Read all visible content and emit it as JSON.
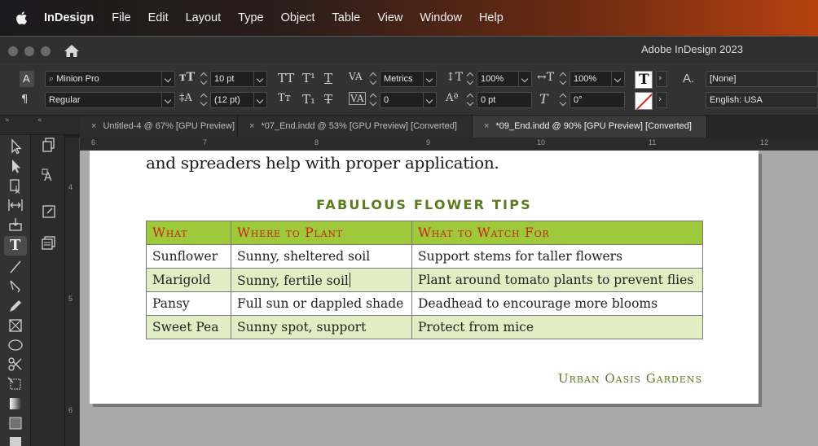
{
  "menubar": {
    "app": "InDesign",
    "items": [
      "File",
      "Edit",
      "Layout",
      "Type",
      "Object",
      "Table",
      "View",
      "Window",
      "Help"
    ]
  },
  "window": {
    "title": "Adobe InDesign 2023"
  },
  "control": {
    "font_family": "Minion Pro",
    "font_style": "Regular",
    "font_size": "10 pt",
    "leading": "(12 pt)",
    "kerning": "Metrics",
    "tracking": "0",
    "vertical_scale": "100%",
    "horizontal_scale": "100%",
    "baseline_shift": "0 pt",
    "skew": "0°",
    "char_style": "[None]",
    "language": "English: USA"
  },
  "tabs": [
    {
      "label": "Untitled-4 @ 67% [GPU Preview]",
      "active": false
    },
    {
      "label": "*07_End.indd @ 53% [GPU Preview] [Converted]",
      "active": false
    },
    {
      "label": "*09_End.indd @ 90% [GPU Preview] [Converted]",
      "active": true
    }
  ],
  "ruler": {
    "h": [
      "6",
      "7",
      "8",
      "9",
      "10",
      "11",
      "12"
    ],
    "v": [
      "4",
      "5",
      "6"
    ]
  },
  "document": {
    "body_line": "and spreaders help with proper application.",
    "table_title": "FABULOUS FLOWER TIPS",
    "headers": [
      "What",
      "Where to Plant",
      "What to Watch For"
    ],
    "rows": [
      [
        "Sunflower",
        "Sunny, sheltered soil",
        "Support stems for taller flowers"
      ],
      [
        "Marigold",
        "Sunny, fertile soil",
        "Plant around tomato plants to prevent flies"
      ],
      [
        "Pansy",
        "Full sun or dappled shade",
        "Deadhead to encourage more blooms"
      ],
      [
        "Sweet Pea",
        "Sunny spot, support",
        "Protect from mice"
      ]
    ],
    "footer": "Urban Oasis Gardens"
  },
  "colors": {
    "header_fill": "#9ec93a",
    "header_text": "#c8241b",
    "alt_row": "#e1eec4",
    "accent_green": "#5c7a1e"
  }
}
